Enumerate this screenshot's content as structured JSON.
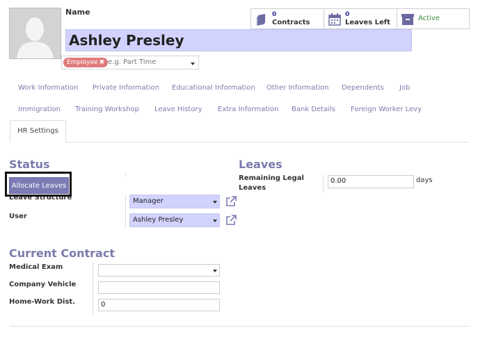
{
  "header": {
    "name_label": "Name",
    "employee_name": "Ashley Presley",
    "tag": "Employee",
    "tag_remove": "✖",
    "category_placeholder": "e.g. Part Time"
  },
  "smart_buttons": {
    "contracts_count": "0",
    "contracts_label": "Contracts",
    "leaves_count": "0",
    "leaves_label": "Leaves Left",
    "active_label": "Active"
  },
  "tabs": [
    "Work Information",
    "Private Information",
    "Educational Information",
    "Other Information",
    "Dependents",
    "Job",
    "Immigration",
    "Training Workshop",
    "Leave History",
    "Extra Information",
    "Bank Details",
    "Foreign Worker Levy",
    "HR Settings"
  ],
  "status": {
    "title": "Status",
    "allocate_button": "Allocate Leaves",
    "leave_structure_label": "Leave Structure",
    "leave_structure_value": "Manager",
    "user_label": "User",
    "user_value": "Ashley Presley"
  },
  "leaves": {
    "title": "Leaves",
    "remaining_label_1": "Remaining Legal",
    "remaining_label_2": "Leaves",
    "remaining_value": "0.00",
    "unit": "days"
  },
  "contract": {
    "title": "Current Contract",
    "medical_exam_label": "Medical Exam",
    "medical_exam_value": "",
    "vehicle_label": "Company Vehicle",
    "vehicle_value": "",
    "distance_label": "Home-Work Dist.",
    "distance_value": "0"
  },
  "colors": {
    "accent": "#7c7bad",
    "input_highlight": "#d2d2ff",
    "tag": "#e07b7b",
    "active": "#3b8a3b"
  }
}
